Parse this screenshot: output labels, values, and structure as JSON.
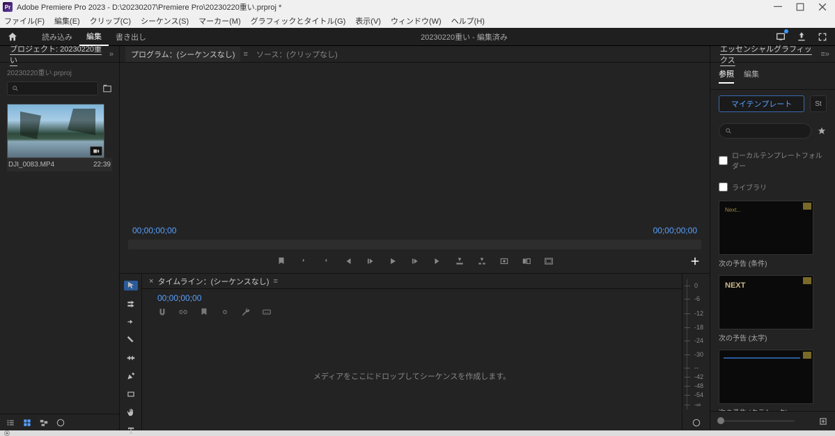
{
  "titlebar": {
    "icon_letter": "Pr",
    "title": "Adobe Premiere Pro 2023 - D:\\20230207\\Premiere Pro\\20230220重い.prproj *"
  },
  "menubar": {
    "items": [
      "ファイル(F)",
      "編集(E)",
      "クリップ(C)",
      "シーケンス(S)",
      "マーカー(M)",
      "グラフィックとタイトル(G)",
      "表示(V)",
      "ウィンドウ(W)",
      "ヘルプ(H)"
    ]
  },
  "workspace": {
    "modes": {
      "import": "読み込み",
      "edit": "編集",
      "export": "書き出し"
    },
    "center_title": "20230220重い - 編集済み"
  },
  "project_panel": {
    "header": "プロジェクト: 20230220重い",
    "path": "20230220重い.prproj",
    "clip": {
      "name": "DJI_0083.MP4",
      "duration": "22:39"
    }
  },
  "center": {
    "tabs": {
      "program": "プログラム：(シーケンスなし)",
      "source": "ソース：(クリップなし)"
    },
    "tc_left": "00;00;00;00",
    "tc_right": "00;00;00;00"
  },
  "timeline": {
    "header": "タイムライン：(シーケンスなし)",
    "tc": "00;00;00;00",
    "drop_hint": "メディアをここにドロップしてシーケンスを作成します。"
  },
  "audio_meter": {
    "ticks": [
      {
        "v": "0",
        "p": 5
      },
      {
        "v": "-6",
        "p": 15
      },
      {
        "v": "-12",
        "p": 26
      },
      {
        "v": "-18",
        "p": 37
      },
      {
        "v": "-24",
        "p": 47
      },
      {
        "v": "-30",
        "p": 58
      },
      {
        "v": "--",
        "p": 68
      },
      {
        "v": "-42",
        "p": 75
      },
      {
        "v": "-48",
        "p": 82
      },
      {
        "v": "-54",
        "p": 89
      },
      {
        "v": "-∞",
        "p": 96
      }
    ]
  },
  "right_panel": {
    "header": "エッセンシャルグラフィックス",
    "tabs": {
      "browse": "参照",
      "edit": "編集"
    },
    "my_templates": "マイテンプレート",
    "sq": "St",
    "check1": "ローカルテンプレートフォルダー",
    "check2": "ライブラリ",
    "check2_hint": "",
    "presets": [
      {
        "label": "次の予告 (条件)",
        "variant": "v1",
        "sample": "Next..."
      },
      {
        "label": "次の予告 (太字)",
        "variant": "v2",
        "sample": "NEXT"
      },
      {
        "label": "次の予告 (クラシック)",
        "variant": "v3"
      }
    ]
  }
}
